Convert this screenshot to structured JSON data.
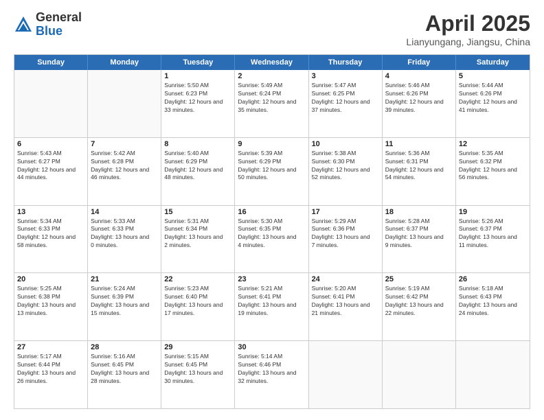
{
  "header": {
    "logo_general": "General",
    "logo_blue": "Blue",
    "month_title": "April 2025",
    "location": "Lianyungang, Jiangsu, China"
  },
  "weekdays": [
    "Sunday",
    "Monday",
    "Tuesday",
    "Wednesday",
    "Thursday",
    "Friday",
    "Saturday"
  ],
  "rows": [
    [
      {
        "day": "",
        "sunrise": "",
        "sunset": "",
        "daylight": ""
      },
      {
        "day": "",
        "sunrise": "",
        "sunset": "",
        "daylight": ""
      },
      {
        "day": "1",
        "sunrise": "Sunrise: 5:50 AM",
        "sunset": "Sunset: 6:23 PM",
        "daylight": "Daylight: 12 hours and 33 minutes."
      },
      {
        "day": "2",
        "sunrise": "Sunrise: 5:49 AM",
        "sunset": "Sunset: 6:24 PM",
        "daylight": "Daylight: 12 hours and 35 minutes."
      },
      {
        "day": "3",
        "sunrise": "Sunrise: 5:47 AM",
        "sunset": "Sunset: 6:25 PM",
        "daylight": "Daylight: 12 hours and 37 minutes."
      },
      {
        "day": "4",
        "sunrise": "Sunrise: 5:46 AM",
        "sunset": "Sunset: 6:26 PM",
        "daylight": "Daylight: 12 hours and 39 minutes."
      },
      {
        "day": "5",
        "sunrise": "Sunrise: 5:44 AM",
        "sunset": "Sunset: 6:26 PM",
        "daylight": "Daylight: 12 hours and 41 minutes."
      }
    ],
    [
      {
        "day": "6",
        "sunrise": "Sunrise: 5:43 AM",
        "sunset": "Sunset: 6:27 PM",
        "daylight": "Daylight: 12 hours and 44 minutes."
      },
      {
        "day": "7",
        "sunrise": "Sunrise: 5:42 AM",
        "sunset": "Sunset: 6:28 PM",
        "daylight": "Daylight: 12 hours and 46 minutes."
      },
      {
        "day": "8",
        "sunrise": "Sunrise: 5:40 AM",
        "sunset": "Sunset: 6:29 PM",
        "daylight": "Daylight: 12 hours and 48 minutes."
      },
      {
        "day": "9",
        "sunrise": "Sunrise: 5:39 AM",
        "sunset": "Sunset: 6:29 PM",
        "daylight": "Daylight: 12 hours and 50 minutes."
      },
      {
        "day": "10",
        "sunrise": "Sunrise: 5:38 AM",
        "sunset": "Sunset: 6:30 PM",
        "daylight": "Daylight: 12 hours and 52 minutes."
      },
      {
        "day": "11",
        "sunrise": "Sunrise: 5:36 AM",
        "sunset": "Sunset: 6:31 PM",
        "daylight": "Daylight: 12 hours and 54 minutes."
      },
      {
        "day": "12",
        "sunrise": "Sunrise: 5:35 AM",
        "sunset": "Sunset: 6:32 PM",
        "daylight": "Daylight: 12 hours and 56 minutes."
      }
    ],
    [
      {
        "day": "13",
        "sunrise": "Sunrise: 5:34 AM",
        "sunset": "Sunset: 6:33 PM",
        "daylight": "Daylight: 12 hours and 58 minutes."
      },
      {
        "day": "14",
        "sunrise": "Sunrise: 5:33 AM",
        "sunset": "Sunset: 6:33 PM",
        "daylight": "Daylight: 13 hours and 0 minutes."
      },
      {
        "day": "15",
        "sunrise": "Sunrise: 5:31 AM",
        "sunset": "Sunset: 6:34 PM",
        "daylight": "Daylight: 13 hours and 2 minutes."
      },
      {
        "day": "16",
        "sunrise": "Sunrise: 5:30 AM",
        "sunset": "Sunset: 6:35 PM",
        "daylight": "Daylight: 13 hours and 4 minutes."
      },
      {
        "day": "17",
        "sunrise": "Sunrise: 5:29 AM",
        "sunset": "Sunset: 6:36 PM",
        "daylight": "Daylight: 13 hours and 7 minutes."
      },
      {
        "day": "18",
        "sunrise": "Sunrise: 5:28 AM",
        "sunset": "Sunset: 6:37 PM",
        "daylight": "Daylight: 13 hours and 9 minutes."
      },
      {
        "day": "19",
        "sunrise": "Sunrise: 5:26 AM",
        "sunset": "Sunset: 6:37 PM",
        "daylight": "Daylight: 13 hours and 11 minutes."
      }
    ],
    [
      {
        "day": "20",
        "sunrise": "Sunrise: 5:25 AM",
        "sunset": "Sunset: 6:38 PM",
        "daylight": "Daylight: 13 hours and 13 minutes."
      },
      {
        "day": "21",
        "sunrise": "Sunrise: 5:24 AM",
        "sunset": "Sunset: 6:39 PM",
        "daylight": "Daylight: 13 hours and 15 minutes."
      },
      {
        "day": "22",
        "sunrise": "Sunrise: 5:23 AM",
        "sunset": "Sunset: 6:40 PM",
        "daylight": "Daylight: 13 hours and 17 minutes."
      },
      {
        "day": "23",
        "sunrise": "Sunrise: 5:21 AM",
        "sunset": "Sunset: 6:41 PM",
        "daylight": "Daylight: 13 hours and 19 minutes."
      },
      {
        "day": "24",
        "sunrise": "Sunrise: 5:20 AM",
        "sunset": "Sunset: 6:41 PM",
        "daylight": "Daylight: 13 hours and 21 minutes."
      },
      {
        "day": "25",
        "sunrise": "Sunrise: 5:19 AM",
        "sunset": "Sunset: 6:42 PM",
        "daylight": "Daylight: 13 hours and 22 minutes."
      },
      {
        "day": "26",
        "sunrise": "Sunrise: 5:18 AM",
        "sunset": "Sunset: 6:43 PM",
        "daylight": "Daylight: 13 hours and 24 minutes."
      }
    ],
    [
      {
        "day": "27",
        "sunrise": "Sunrise: 5:17 AM",
        "sunset": "Sunset: 6:44 PM",
        "daylight": "Daylight: 13 hours and 26 minutes."
      },
      {
        "day": "28",
        "sunrise": "Sunrise: 5:16 AM",
        "sunset": "Sunset: 6:45 PM",
        "daylight": "Daylight: 13 hours and 28 minutes."
      },
      {
        "day": "29",
        "sunrise": "Sunrise: 5:15 AM",
        "sunset": "Sunset: 6:45 PM",
        "daylight": "Daylight: 13 hours and 30 minutes."
      },
      {
        "day": "30",
        "sunrise": "Sunrise: 5:14 AM",
        "sunset": "Sunset: 6:46 PM",
        "daylight": "Daylight: 13 hours and 32 minutes."
      },
      {
        "day": "",
        "sunrise": "",
        "sunset": "",
        "daylight": ""
      },
      {
        "day": "",
        "sunrise": "",
        "sunset": "",
        "daylight": ""
      },
      {
        "day": "",
        "sunrise": "",
        "sunset": "",
        "daylight": ""
      }
    ]
  ]
}
